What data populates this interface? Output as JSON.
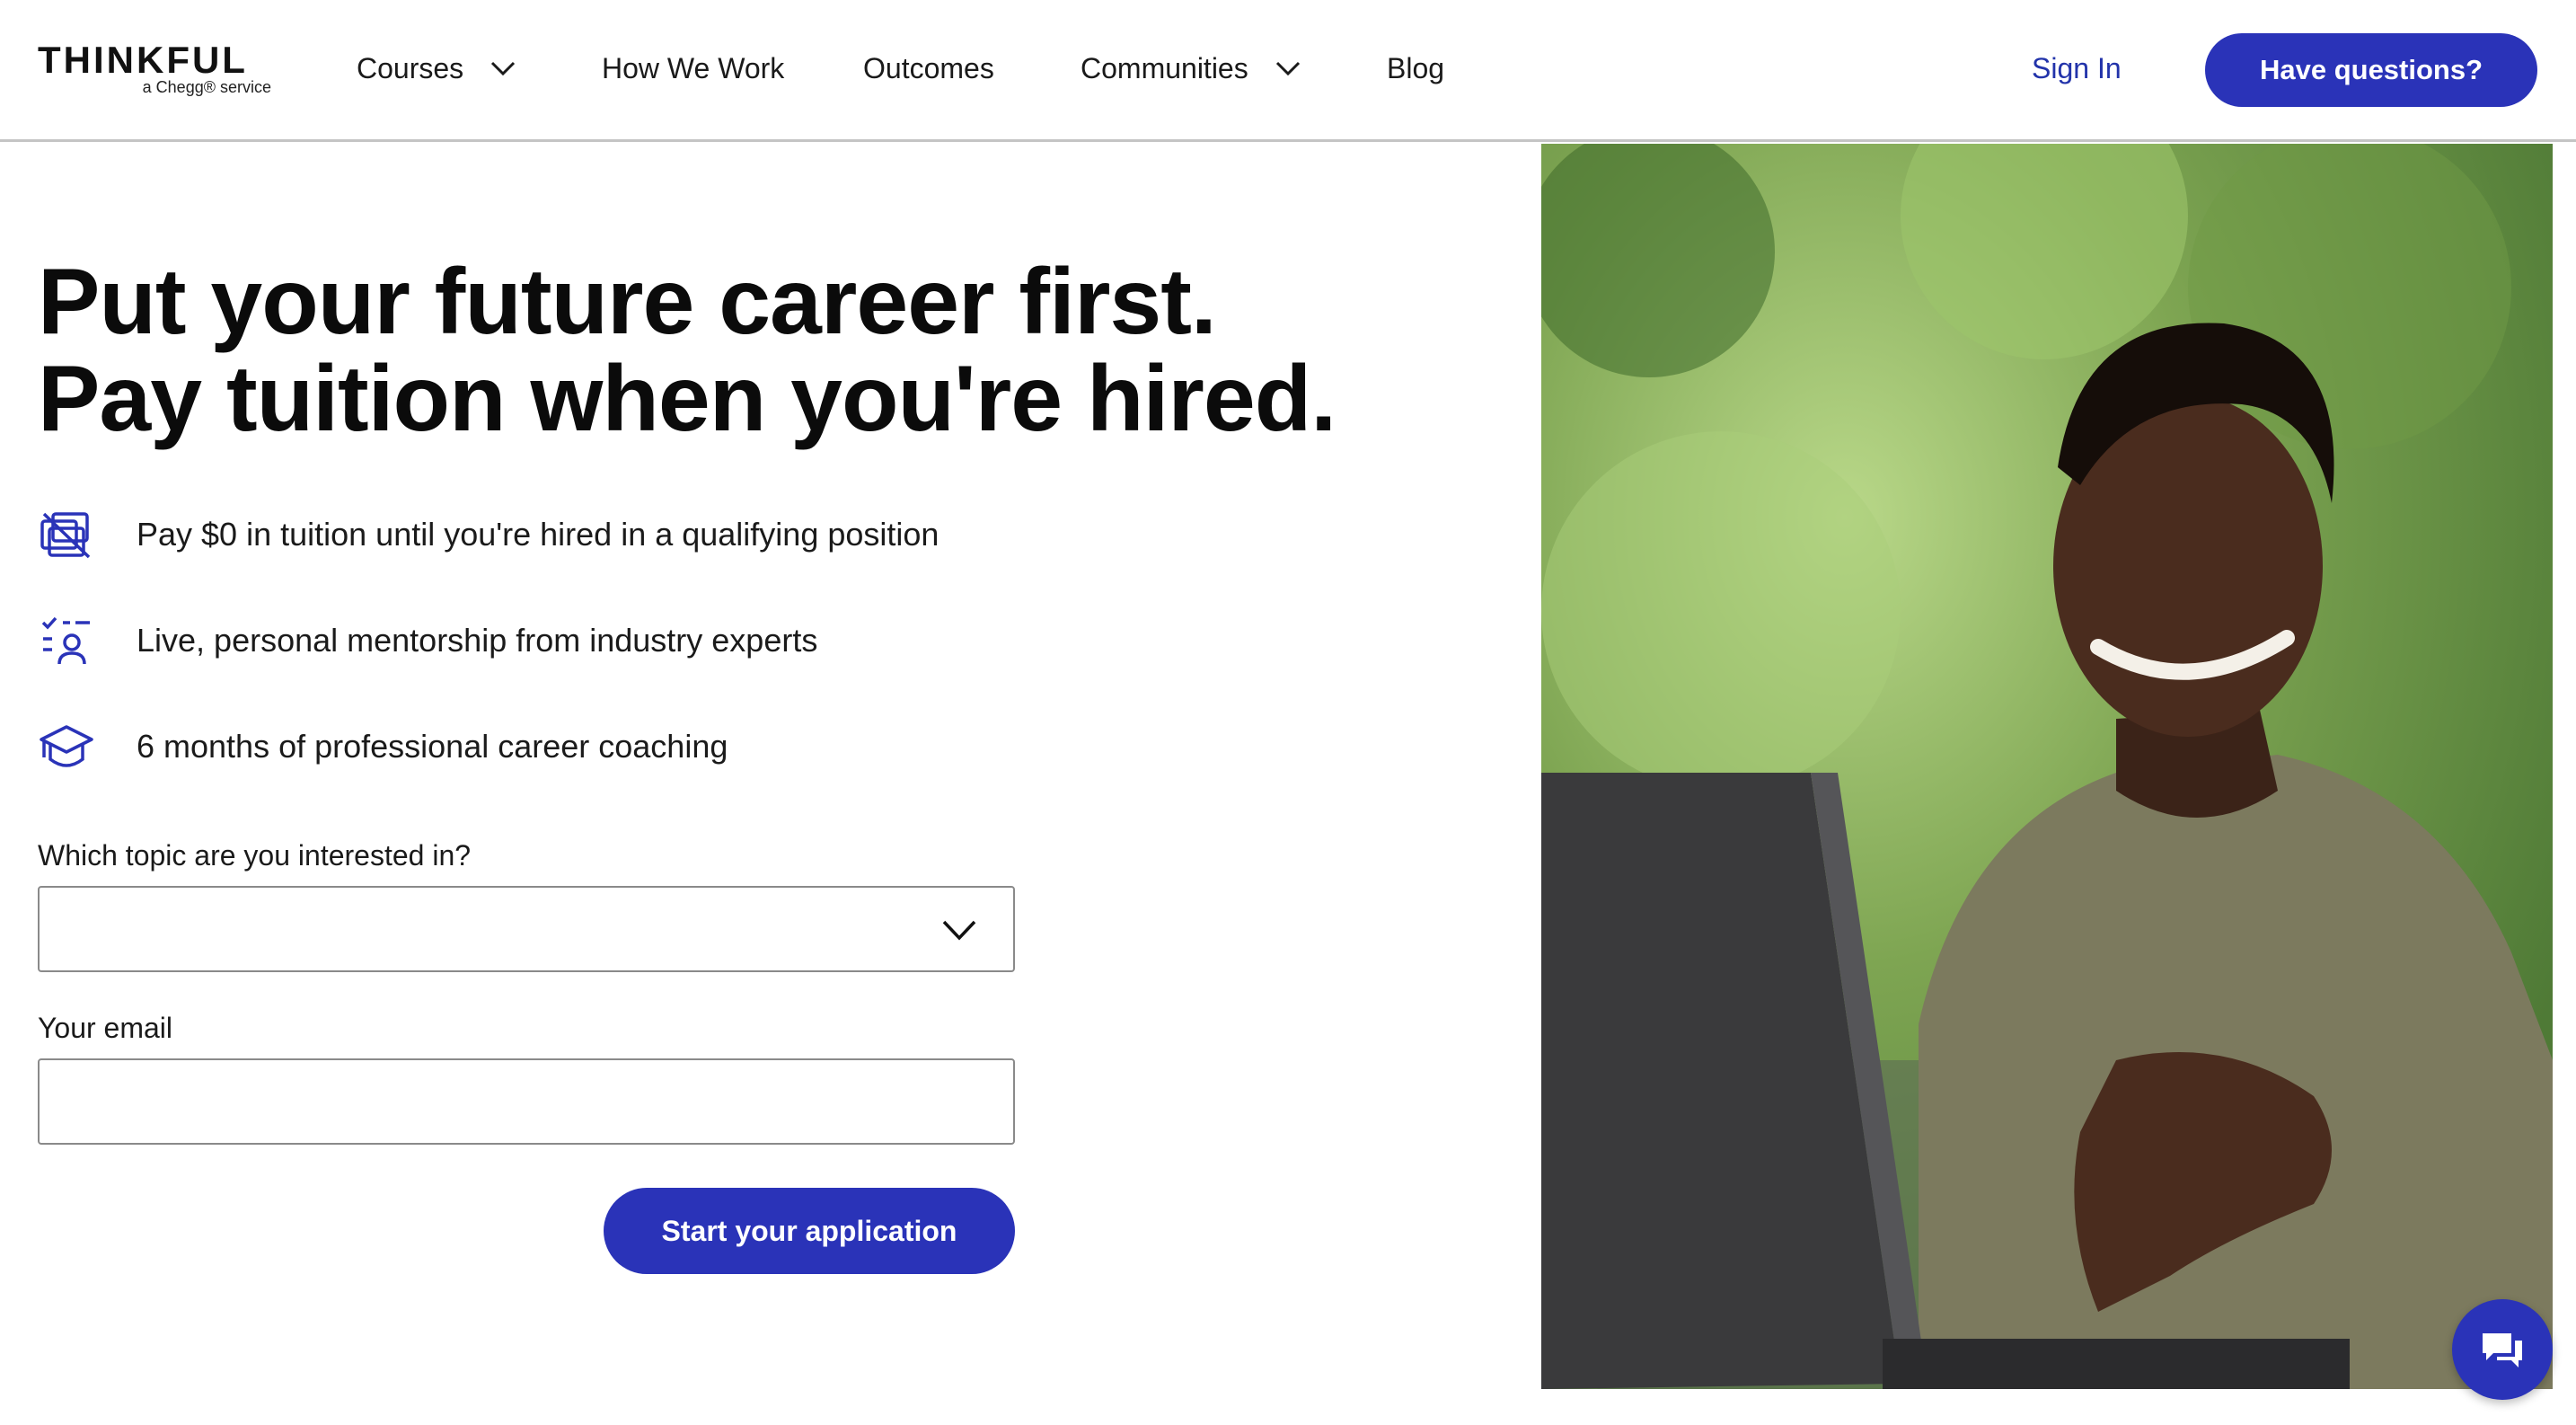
{
  "brand": {
    "name": "THINKFUL",
    "tagline": "a Chegg® service",
    "accent": "#2a33b8"
  },
  "nav": {
    "items": [
      {
        "label": "Courses",
        "has_dropdown": true
      },
      {
        "label": "How We Work",
        "has_dropdown": false
      },
      {
        "label": "Outcomes",
        "has_dropdown": false
      },
      {
        "label": "Communities",
        "has_dropdown": true
      },
      {
        "label": "Blog",
        "has_dropdown": false
      }
    ],
    "sign_in": "Sign In",
    "cta": "Have questions?"
  },
  "hero": {
    "headline_line1": "Put your future career first.",
    "headline_line2": "Pay tuition when you're hired.",
    "features": [
      {
        "icon": "no-cost-icon",
        "text": "Pay $0 in tuition until you're hired in a qualifying position"
      },
      {
        "icon": "mentor-icon",
        "text": "Live, personal mentorship from industry experts"
      },
      {
        "icon": "graduation-cap-icon",
        "text": "6 months of professional career coaching"
      }
    ]
  },
  "form": {
    "topic_label": "Which topic are you interested in?",
    "topic_value": "",
    "email_label": "Your email",
    "email_value": "",
    "email_placeholder": "",
    "submit_label": "Start your application"
  },
  "chat": {
    "icon": "chat-icon"
  }
}
